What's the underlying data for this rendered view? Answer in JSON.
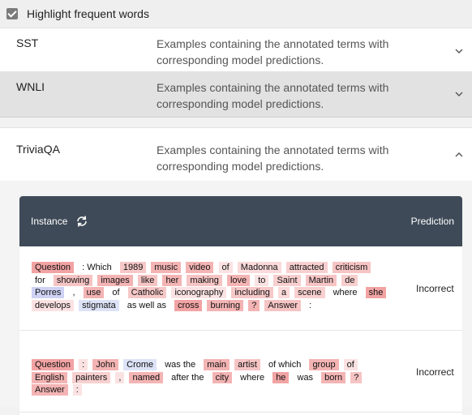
{
  "top": {
    "checkbox_label": "Highlight frequent words",
    "checked": true
  },
  "panels": [
    {
      "name": "SST",
      "description": "Examples containing the annotated terms with corresponding model predictions.",
      "expanded": false
    },
    {
      "name": "WNLI",
      "description": "Examples containing the annotated terms with corresponding model predictions.",
      "expanded": false
    },
    {
      "name": "TriviaQA",
      "description": "Examples containing the annotated terms with corresponding model predictions.",
      "expanded": true
    }
  ],
  "table": {
    "instance_header": "Instance",
    "prediction_header": "Prediction",
    "rows": [
      {
        "prediction": "Incorrect",
        "tokens": [
          {
            "t": "Question",
            "c": "#f2a3a3"
          },
          {
            "t": ": Which",
            "c": ""
          },
          {
            "t": "1989",
            "c": "#f6c8c8"
          },
          {
            "t": "music",
            "c": "#f4b4b4"
          },
          {
            "t": "video",
            "c": "#f4b4b4"
          },
          {
            "t": "of",
            "c": "#fbe2e2"
          },
          {
            "t": "Madonna",
            "c": "#fadada"
          },
          {
            "t": "attracted",
            "c": "#f8d0d0"
          },
          {
            "t": "criticism",
            "c": "#f6c4c4"
          },
          {
            "t": "for",
            "c": ""
          },
          {
            "t": "showing",
            "c": "#f6c4c4"
          },
          {
            "t": "images",
            "c": "#f4b4b4"
          },
          {
            "t": "like",
            "c": "#f6c4c4"
          },
          {
            "t": "her",
            "c": "#f4b4b4"
          },
          {
            "t": "making",
            "c": "#f6c4c4"
          },
          {
            "t": "love",
            "c": "#f4b4b4"
          },
          {
            "t": "to",
            "c": "#fbe2e2"
          },
          {
            "t": "Saint",
            "c": "#f8cfcf"
          },
          {
            "t": "Martin",
            "c": "#f6c4c4"
          },
          {
            "t": "de",
            "c": "#f8cfcf"
          },
          {
            "t": "Porres",
            "c": "#cfd2f4"
          },
          {
            "t": ",",
            "c": ""
          },
          {
            "t": "use",
            "c": "#f4b4b4"
          },
          {
            "t": "of",
            "c": ""
          },
          {
            "t": "Catholic",
            "c": "#f6c8c8"
          },
          {
            "t": "iconography",
            "c": "#fbe2e2"
          },
          {
            "t": "including",
            "c": "#f6c8c8"
          },
          {
            "t": "a",
            "c": "#fadada"
          },
          {
            "t": "scene",
            "c": "#f8d0d0"
          },
          {
            "t": "where",
            "c": ""
          },
          {
            "t": "she",
            "c": "#f2a3a3"
          },
          {
            "t": "develops",
            "c": "#fbe2e2"
          },
          {
            "t": "stigmata",
            "c": "#dde3f7"
          },
          {
            "t": "as well as",
            "c": ""
          },
          {
            "t": "cross",
            "c": "#f2a3a3"
          },
          {
            "t": "burning",
            "c": "#f4b4b4"
          },
          {
            "t": "?",
            "c": "#f4b4b4"
          },
          {
            "t": "Answer",
            "c": "#f6c4c4"
          },
          {
            "t": ":",
            "c": ""
          }
        ]
      },
      {
        "prediction": "Incorrect",
        "tokens": [
          {
            "t": "Question",
            "c": "#f2a3a3"
          },
          {
            "t": ":",
            "c": "#fbe2e2"
          },
          {
            "t": "John",
            "c": "#f4b4b4"
          },
          {
            "t": "Crome",
            "c": "#dde3f7"
          },
          {
            "t": "was the",
            "c": ""
          },
          {
            "t": "main",
            "c": "#f4b4b4"
          },
          {
            "t": "artist",
            "c": "#f6c4c4"
          },
          {
            "t": "of which",
            "c": ""
          },
          {
            "t": "group",
            "c": "#f4b4b4"
          },
          {
            "t": "of",
            "c": "#fbe2e2"
          },
          {
            "t": "English",
            "c": "#f4b4b4"
          },
          {
            "t": "painters",
            "c": "#f8d0d0"
          },
          {
            "t": ",",
            "c": "#fbe2e2"
          },
          {
            "t": "named",
            "c": "#f4b4b4"
          },
          {
            "t": "after the",
            "c": ""
          },
          {
            "t": "city",
            "c": "#f4b4b4"
          },
          {
            "t": "where",
            "c": ""
          },
          {
            "t": "he",
            "c": "#f2a3a3"
          },
          {
            "t": "was",
            "c": ""
          },
          {
            "t": "born",
            "c": "#f4b4b4"
          },
          {
            "t": "?",
            "c": "#f6c4c4"
          },
          {
            "t": "Answer",
            "c": "#f4b4b4"
          },
          {
            "t": ":",
            "c": "#fbe2e2"
          }
        ]
      }
    ]
  }
}
